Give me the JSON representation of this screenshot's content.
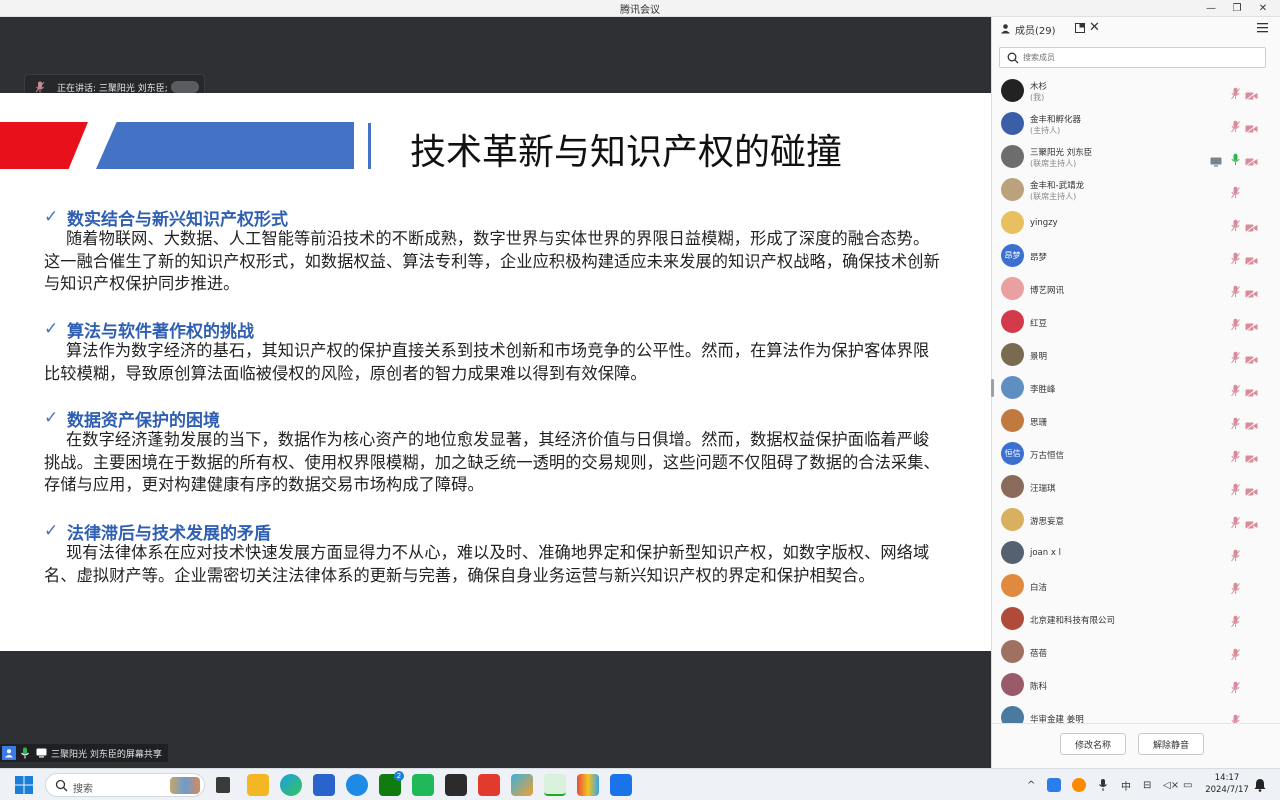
{
  "window": {
    "title": "腾讯会议",
    "controls": [
      "—",
      "❐",
      "✕"
    ]
  },
  "speaker_pill": {
    "label": "正在讲话:  三聚阳光 刘东臣;"
  },
  "slide": {
    "title": "技术革新与知识产权的碰撞",
    "check": "✓",
    "sections": [
      {
        "heading": "数实结合与新兴知识产权形式",
        "body": "随着物联网、大数据、人工智能等前沿技术的不断成熟，数字世界与实体世界的界限日益模糊，形成了深度的融合态势。这一融合催生了新的知识产权形式，如数据权益、算法专利等，企业应积极构建适应未来发展的知识产权战略，确保技术创新与知识产权保护同步推进。"
      },
      {
        "heading": "算法与软件著作权的挑战",
        "body": "算法作为数字经济的基石，其知识产权的保护直接关系到技术创新和市场竞争的公平性。然而，在算法作为保护客体界限比较模糊，导致原创算法面临被侵权的风险，原创者的智力成果难以得到有效保障。"
      },
      {
        "heading": "数据资产保护的困境",
        "body": "在数字经济蓬勃发展的当下，数据作为核心资产的地位愈发显著，其经济价值与日俱增。然而，数据权益保护面临着严峻挑战。主要困境在于数据的所有权、使用权界限模糊，加之缺乏统一透明的交易规则，这些问题不仅阻碍了数据的合法采集、存储与应用，更对构建健康有序的数据交易市场构成了障碍。"
      },
      {
        "heading": "法律滞后与技术发展的矛盾",
        "body": "现有法律体系在应对技术快速发展方面显得力不从心，难以及时、准确地界定和保护新型知识产权，如数字版权、网络域名、虚拟财产等。企业需密切关注法律体系的更新与完善，确保自身业务运营与新兴知识产权的界定和保护相契合。"
      }
    ]
  },
  "share_status": {
    "text": "三聚阳光 刘东臣的屏幕共享"
  },
  "panel": {
    "title": "成员(29)",
    "search_placeholder": "搜索成员",
    "members": [
      {
        "name": "木杉",
        "role": "(我)",
        "mic": "muted",
        "cam": "off",
        "avatar_color": "#222222",
        "avatar_text": ""
      },
      {
        "name": "金丰和孵化器",
        "role": "(主持人)",
        "mic": "muted",
        "cam": "off",
        "avatar_color": "#3a5fa8",
        "avatar_text": ""
      },
      {
        "name": "三聚阳光 刘东臣",
        "role": "(联席主持人)",
        "mic": "on",
        "cam": "off",
        "screen": true,
        "avatar_color": "#6d6d6d",
        "avatar_text": ""
      },
      {
        "name": "金丰和-武靖龙",
        "role": "(联席主持人)",
        "mic": "muted",
        "cam": "none",
        "avatar_color": "#b9a27c",
        "avatar_text": ""
      },
      {
        "name": "yingzy",
        "role": "",
        "mic": "muted",
        "cam": "off",
        "avatar_color": "#e8c060",
        "avatar_text": ""
      },
      {
        "name": "昂梦",
        "role": "",
        "mic": "muted",
        "cam": "off",
        "avatar_color": "#3b6fd0",
        "avatar_text": "昂梦"
      },
      {
        "name": "博艺网讯",
        "role": "",
        "mic": "muted",
        "cam": "off",
        "avatar_color": "#e9a0a0",
        "avatar_text": ""
      },
      {
        "name": "红豆",
        "role": "",
        "mic": "muted",
        "cam": "off",
        "avatar_color": "#d23a4a",
        "avatar_text": ""
      },
      {
        "name": "景明",
        "role": "",
        "mic": "muted",
        "cam": "off",
        "avatar_color": "#7a6a50",
        "avatar_text": ""
      },
      {
        "name": "李胜峰",
        "role": "",
        "mic": "muted",
        "cam": "off",
        "avatar_color": "#5e8fc0",
        "avatar_text": ""
      },
      {
        "name": "思珊",
        "role": "",
        "mic": "muted",
        "cam": "off",
        "avatar_color": "#c07a40",
        "avatar_text": ""
      },
      {
        "name": "万古恒信",
        "role": "",
        "mic": "muted",
        "cam": "off",
        "avatar_color": "#3b6fd0",
        "avatar_text": "恒信"
      },
      {
        "name": "汪瑞琪",
        "role": "",
        "mic": "muted",
        "cam": "off",
        "avatar_color": "#8a6a5a",
        "avatar_text": ""
      },
      {
        "name": "游思妄意",
        "role": "",
        "mic": "muted",
        "cam": "off",
        "avatar_color": "#d8b060",
        "avatar_text": ""
      },
      {
        "name": "joan x l",
        "role": "",
        "mic": "muted",
        "cam": "none",
        "avatar_color": "#556070",
        "avatar_text": ""
      },
      {
        "name": "白洁",
        "role": "",
        "mic": "muted",
        "cam": "none",
        "avatar_color": "#e08a40",
        "avatar_text": ""
      },
      {
        "name": "北京建和科技有限公司",
        "role": "",
        "mic": "muted",
        "cam": "none",
        "avatar_color": "#b04a3a",
        "avatar_text": ""
      },
      {
        "name": "蓓蓓",
        "role": "",
        "mic": "muted",
        "cam": "none",
        "avatar_color": "#a07060",
        "avatar_text": ""
      },
      {
        "name": "陈科",
        "role": "",
        "mic": "muted",
        "cam": "none",
        "avatar_color": "#9a5a6a",
        "avatar_text": ""
      },
      {
        "name": "华审金建 姜明",
        "role": "",
        "mic": "muted",
        "cam": "none",
        "avatar_color": "#4a7aa0",
        "avatar_text": ""
      }
    ],
    "rename_button": "修改名称",
    "unmute_button": "解除静音"
  },
  "taskbar": {
    "search_placeholder": "搜索",
    "tray_ime": "中",
    "time": "14:17",
    "date": "2024/7/17",
    "badge": "2"
  },
  "colors": {
    "slide_red": "#e8101a",
    "slide_blue": "#4472c4",
    "heading_blue": "#2f5fb3",
    "mic_muted": "#d98b9b",
    "mic_on": "#2db84d"
  }
}
